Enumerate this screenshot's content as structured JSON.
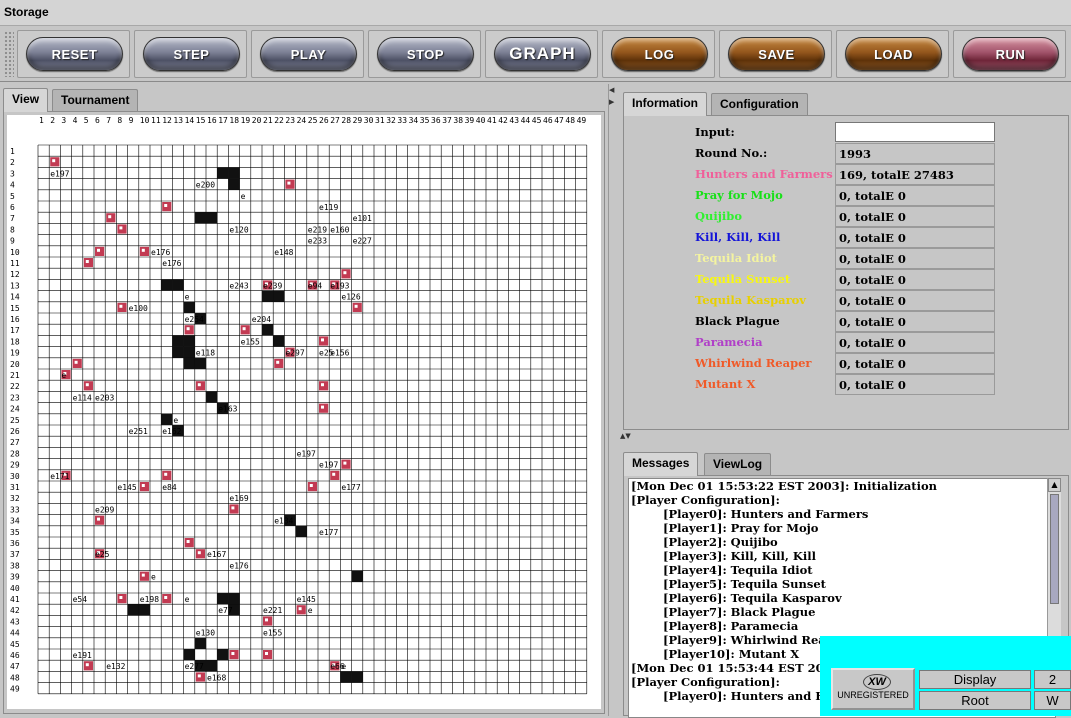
{
  "window": {
    "title": "Storage"
  },
  "toolbar": {
    "buttons": [
      {
        "label": "RESET",
        "style": "metal"
      },
      {
        "label": "STEP",
        "style": "metal"
      },
      {
        "label": "PLAY",
        "style": "metal"
      },
      {
        "label": "STOP",
        "style": "metal"
      },
      {
        "label": "GRAPH",
        "style": "metal"
      },
      {
        "label": "LOG",
        "style": "wood"
      },
      {
        "label": "SAVE",
        "style": "wood"
      },
      {
        "label": "LOAD",
        "style": "wood"
      },
      {
        "label": "RUN",
        "style": "red"
      }
    ]
  },
  "left_panel": {
    "tabs": [
      {
        "label": "View"
      },
      {
        "label": "Tournament"
      }
    ],
    "grid": {
      "columns": 49,
      "rows": 49,
      "colony_color": "#c23a52",
      "marks": [
        [
          1,
          2,
          "e197"
        ],
        [
          14,
          3,
          "e200"
        ],
        [
          18,
          4,
          "e"
        ],
        [
          25,
          5,
          "e119"
        ],
        [
          28,
          6,
          "e101"
        ],
        [
          24,
          7,
          "e219"
        ],
        [
          17,
          7,
          "e120"
        ],
        [
          26,
          7,
          "e160"
        ],
        [
          24,
          8,
          "e233"
        ],
        [
          28,
          8,
          "e227"
        ],
        [
          10,
          9,
          "e176"
        ],
        [
          21,
          9,
          "e148"
        ],
        [
          11,
          10,
          "e176"
        ],
        [
          26,
          12,
          "e193"
        ],
        [
          20,
          12,
          "e239"
        ],
        [
          17,
          12,
          "e243"
        ],
        [
          24,
          12,
          "e94"
        ],
        [
          13,
          13,
          "e"
        ],
        [
          27,
          13,
          "e126"
        ],
        [
          8,
          14,
          "e100"
        ],
        [
          13,
          15,
          "e254"
        ],
        [
          19,
          15,
          "e204"
        ],
        [
          18,
          17,
          "e155"
        ],
        [
          14,
          18,
          "e118"
        ],
        [
          22,
          18,
          "e297"
        ],
        [
          25,
          18,
          "e25"
        ],
        [
          26,
          18,
          "e156"
        ],
        [
          2,
          20,
          "e"
        ],
        [
          5,
          22,
          "e203"
        ],
        [
          3,
          22,
          "e114"
        ],
        [
          16,
          23,
          "e163"
        ],
        [
          12,
          24,
          "e"
        ],
        [
          8,
          25,
          "e251"
        ],
        [
          11,
          25,
          "e162"
        ],
        [
          23,
          27,
          "e197"
        ],
        [
          1,
          29,
          "e171"
        ],
        [
          25,
          28,
          "e197"
        ],
        [
          27,
          30,
          "e177"
        ],
        [
          11,
          30,
          "e84"
        ],
        [
          7,
          30,
          "e145"
        ],
        [
          17,
          31,
          "e169"
        ],
        [
          5,
          32,
          "e209"
        ],
        [
          21,
          33,
          "e134"
        ],
        [
          25,
          34,
          "e177"
        ],
        [
          5,
          36,
          "e25"
        ],
        [
          15,
          36,
          "e167"
        ],
        [
          17,
          37,
          "e176"
        ],
        [
          10,
          38,
          "e"
        ],
        [
          3,
          40,
          "e54"
        ],
        [
          9,
          40,
          "e198"
        ],
        [
          13,
          40,
          "e"
        ],
        [
          23,
          40,
          "e145"
        ],
        [
          24,
          41,
          "e"
        ],
        [
          20,
          41,
          "e221"
        ],
        [
          16,
          41,
          "e77"
        ],
        [
          14,
          43,
          "e130"
        ],
        [
          20,
          43,
          "e155"
        ],
        [
          3,
          45,
          "e191"
        ],
        [
          6,
          46,
          "e132"
        ],
        [
          13,
          46,
          "e277"
        ],
        [
          27,
          46,
          "e"
        ],
        [
          15,
          47,
          "e168"
        ],
        [
          26,
          46,
          "e66"
        ]
      ],
      "black_cells": [
        [
          16,
          2
        ],
        [
          17,
          2
        ],
        [
          17,
          3
        ],
        [
          14,
          6
        ],
        [
          15,
          6
        ],
        [
          11,
          12
        ],
        [
          12,
          12
        ],
        [
          13,
          14
        ],
        [
          14,
          15
        ],
        [
          20,
          13
        ],
        [
          21,
          13
        ],
        [
          12,
          17
        ],
        [
          13,
          17
        ],
        [
          13,
          18
        ],
        [
          12,
          18
        ],
        [
          13,
          19
        ],
        [
          14,
          19
        ],
        [
          20,
          16
        ],
        [
          21,
          17
        ],
        [
          15,
          22
        ],
        [
          16,
          23
        ],
        [
          11,
          24
        ],
        [
          12,
          25
        ],
        [
          22,
          33
        ],
        [
          23,
          34
        ],
        [
          28,
          38
        ],
        [
          14,
          44
        ],
        [
          16,
          45
        ],
        [
          13,
          45
        ],
        [
          14,
          46
        ],
        [
          15,
          46
        ],
        [
          8,
          41
        ],
        [
          9,
          41
        ],
        [
          16,
          40
        ],
        [
          17,
          40
        ],
        [
          17,
          41
        ],
        [
          27,
          47
        ],
        [
          28,
          47
        ]
      ],
      "pink_cells": [
        [
          1,
          1
        ],
        [
          22,
          3
        ],
        [
          11,
          5
        ],
        [
          6,
          6
        ],
        [
          7,
          7
        ],
        [
          9,
          9
        ],
        [
          5,
          9
        ],
        [
          4,
          10
        ],
        [
          7,
          14
        ],
        [
          20,
          12
        ],
        [
          24,
          12
        ],
        [
          26,
          12
        ],
        [
          28,
          14
        ],
        [
          18,
          16
        ],
        [
          22,
          18
        ],
        [
          21,
          19
        ],
        [
          25,
          17
        ],
        [
          27,
          11
        ],
        [
          13,
          16
        ],
        [
          2,
          20
        ],
        [
          3,
          19
        ],
        [
          4,
          21
        ],
        [
          14,
          21
        ],
        [
          25,
          21
        ],
        [
          25,
          23
        ],
        [
          24,
          30
        ],
        [
          26,
          29
        ],
        [
          27,
          28
        ],
        [
          2,
          29
        ],
        [
          11,
          29
        ],
        [
          9,
          30
        ],
        [
          17,
          32
        ],
        [
          5,
          33
        ],
        [
          5,
          36
        ],
        [
          13,
          35
        ],
        [
          14,
          36
        ],
        [
          9,
          38
        ],
        [
          11,
          40
        ],
        [
          7,
          40
        ],
        [
          17,
          45
        ],
        [
          20,
          45
        ],
        [
          26,
          46
        ],
        [
          4,
          46
        ],
        [
          14,
          47
        ],
        [
          20,
          42
        ],
        [
          23,
          41
        ]
      ],
      "black_cells_extra": []
    }
  },
  "info_panel": {
    "tabs": [
      {
        "label": "Information"
      },
      {
        "label": "Configuration"
      }
    ],
    "input_label": "Input:",
    "input_value": "",
    "rows": [
      {
        "label": "Round No.:",
        "value": "1993",
        "color": "#000000"
      },
      {
        "label": "Hunters and Farmers",
        "value": "169, totalE 27483",
        "color": "#f0609a"
      },
      {
        "label": "Pray for Mojo",
        "value": "0, totalE 0",
        "color": "#18e018"
      },
      {
        "label": "Quijibo",
        "value": "0, totalE 0",
        "color": "#30f030"
      },
      {
        "label": "Kill, Kill, Kill",
        "value": "0, totalE 0",
        "color": "#1414d8"
      },
      {
        "label": "Tequila Idiot",
        "value": "0, totalE 0",
        "color": "#f4f4a0"
      },
      {
        "label": "Tequila Sunset",
        "value": "0, totalE 0",
        "color": "#f8f810"
      },
      {
        "label": "Tequila Kasparov",
        "value": "0, totalE 0",
        "color": "#e8d000"
      },
      {
        "label": "Black Plague",
        "value": "0, totalE 0",
        "color": "#000000"
      },
      {
        "label": "Paramecia",
        "value": "0, totalE 0",
        "color": "#b040c8"
      },
      {
        "label": "Whirlwind Reaper",
        "value": "0, totalE 0",
        "color": "#f05a28"
      },
      {
        "label": "Mutant X",
        "value": "0, totalE 0",
        "color": "#f05a28"
      }
    ]
  },
  "messages_panel": {
    "tabs": [
      {
        "label": "Messages"
      },
      {
        "label": "ViewLog"
      }
    ],
    "lines": [
      "[Mon Dec 01 15:53:22 EST 2003]: Initialization",
      "[Player Configuration]:",
      "        [Player0]: Hunters and Farmers",
      "        [Player1]: Pray for Mojo",
      "        [Player2]: Quijibo",
      "        [Player3]: Kill, Kill, Kill",
      "        [Player4]: Tequila Idiot",
      "        [Player5]: Tequila Sunset",
      "        [Player6]: Tequila Kasparov",
      "        [Player7]: Black Plague",
      "        [Player8]: Paramecia",
      "        [Player9]: Whirlwind Reaper",
      "        [Player10]: Mutant X",
      "[Mon Dec 01 15:53:44 EST 2003]: Initialization",
      "[Player Configuration]:",
      "        [Player0]: Hunters and Farmers"
    ]
  },
  "taskbar": {
    "unregistered_label": "UNREGISTERED",
    "logo_text": "XW",
    "buttons": [
      {
        "label": "Display"
      },
      {
        "label": "Root"
      },
      {
        "label": "2"
      },
      {
        "label": "W"
      }
    ]
  },
  "colors": {
    "overlay": "#00ffff",
    "grid_line": "#000000",
    "colony": "#c23a52"
  }
}
